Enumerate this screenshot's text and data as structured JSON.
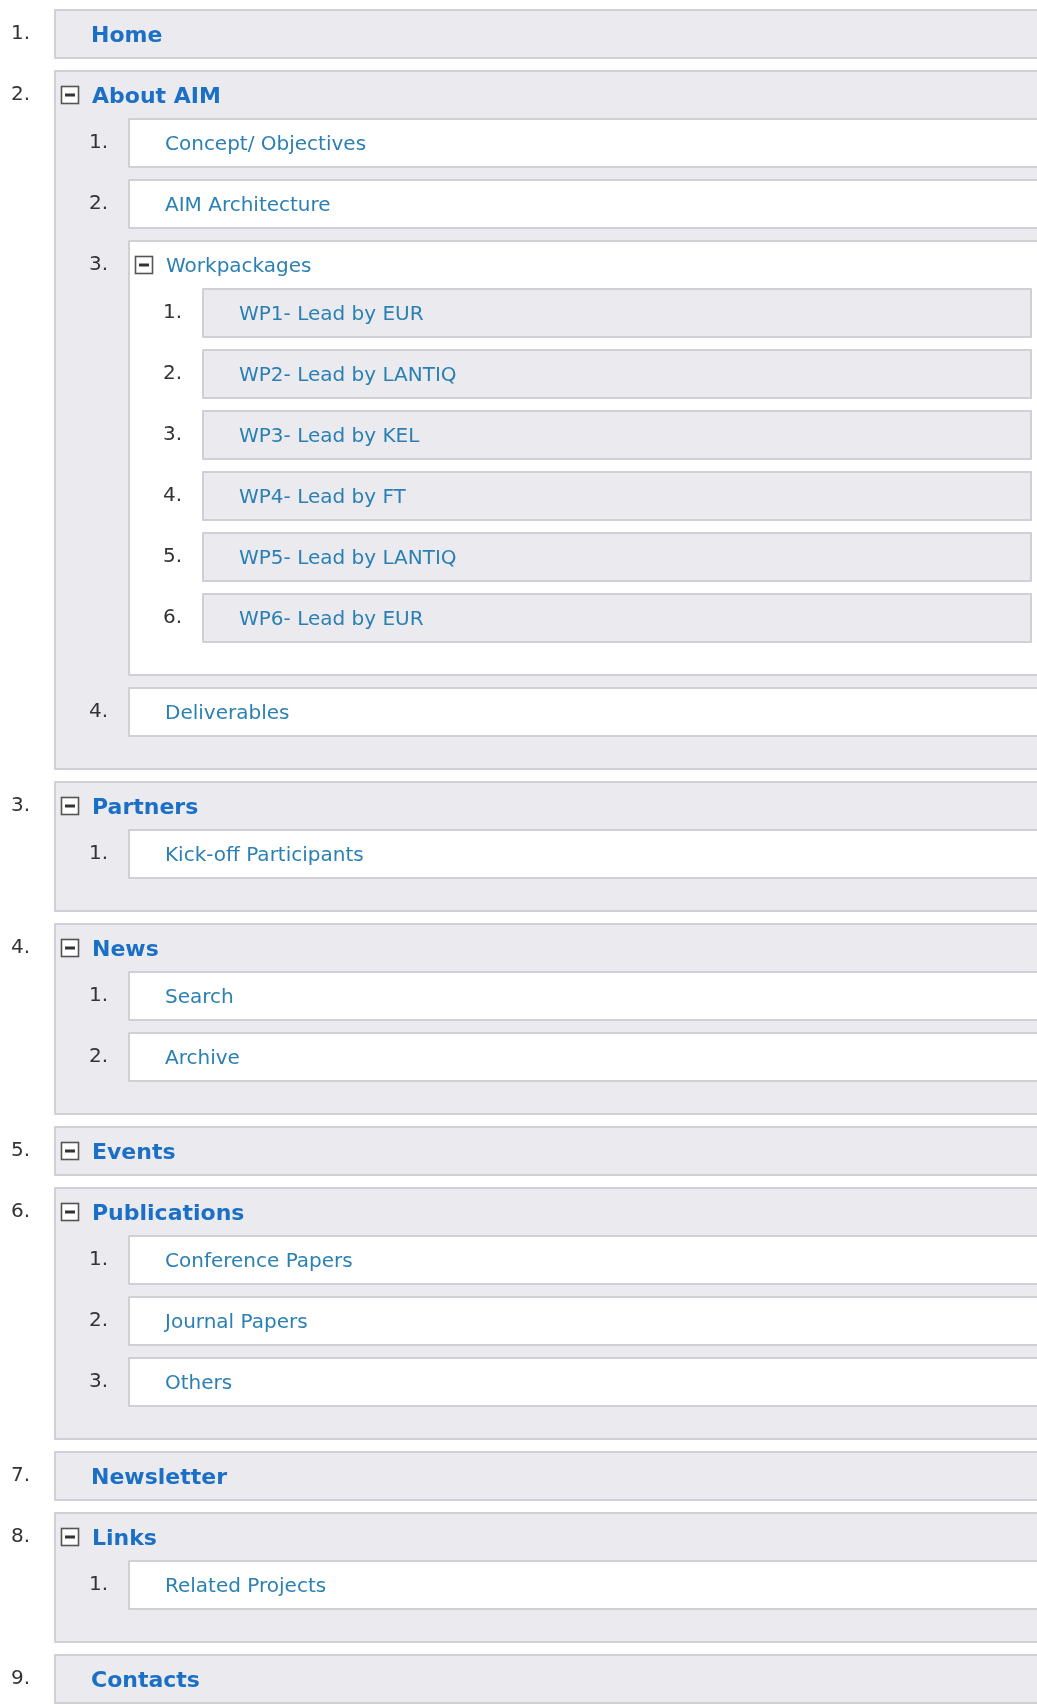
{
  "menu": [
    {
      "number": "1.",
      "label": "Home"
    },
    {
      "number": "2.",
      "label": "About AIM",
      "expanded": true,
      "children": [
        {
          "number": "1.",
          "label": "Concept/ Objectives"
        },
        {
          "number": "2.",
          "label": "AIM Architecture"
        },
        {
          "number": "3.",
          "label": "Workpackages",
          "expanded": true,
          "children": [
            {
              "number": "1.",
              "label": "WP1- Lead by EUR"
            },
            {
              "number": "2.",
              "label": "WP2- Lead by LANTIQ"
            },
            {
              "number": "3.",
              "label": "WP3- Lead by KEL"
            },
            {
              "number": "4.",
              "label": "WP4- Lead by FT"
            },
            {
              "number": "5.",
              "label": "WP5- Lead by LANTIQ"
            },
            {
              "number": "6.",
              "label": "WP6- Lead by EUR"
            }
          ]
        },
        {
          "number": "4.",
          "label": "Deliverables"
        }
      ]
    },
    {
      "number": "3.",
      "label": "Partners",
      "expanded": true,
      "children": [
        {
          "number": "1.",
          "label": "Kick-off Participants"
        }
      ]
    },
    {
      "number": "4.",
      "label": "News",
      "expanded": true,
      "children": [
        {
          "number": "1.",
          "label": "Search"
        },
        {
          "number": "2.",
          "label": "Archive"
        }
      ]
    },
    {
      "number": "5.",
      "label": "Events",
      "expanded": true
    },
    {
      "number": "6.",
      "label": "Publications",
      "expanded": true,
      "children": [
        {
          "number": "1.",
          "label": "Conference Papers"
        },
        {
          "number": "2.",
          "label": "Journal Papers"
        },
        {
          "number": "3.",
          "label": "Others"
        }
      ]
    },
    {
      "number": "7.",
      "label": "Newsletter"
    },
    {
      "number": "8.",
      "label": "Links",
      "expanded": true,
      "children": [
        {
          "number": "1.",
          "label": "Related Projects"
        }
      ]
    },
    {
      "number": "9.",
      "label": "Contacts"
    }
  ]
}
